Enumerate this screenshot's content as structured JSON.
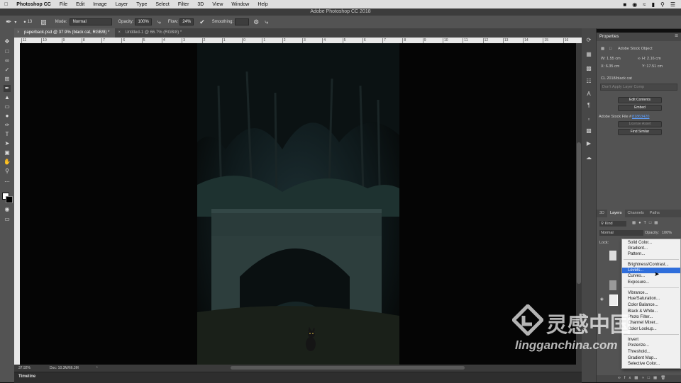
{
  "menubar": {
    "app": "Photoshop CC",
    "items": [
      "File",
      "Edit",
      "Image",
      "Layer",
      "Type",
      "Select",
      "Filter",
      "3D",
      "View",
      "Window",
      "Help"
    ]
  },
  "window_title": "Adobe Photoshop CC 2018",
  "options": {
    "size": "13",
    "mode_label": "Mode:",
    "mode_value": "Normal",
    "opacity_label": "Opacity:",
    "opacity_value": "100%",
    "flow_label": "Flow:",
    "flow_value": "24%",
    "smoothing_label": "Smoothing:"
  },
  "tabs": [
    {
      "label": "paperback.psd @ 37.9% (black cat, RGB/8) *",
      "active": true
    },
    {
      "label": "Untitled-1 @ 66.7% (RGB/8) *",
      "active": false
    }
  ],
  "ruler": {
    "ticks": [
      "11",
      "10",
      "9",
      "8",
      "7",
      "6",
      "5",
      "4",
      "3",
      "2",
      "1",
      "0",
      "1",
      "2",
      "3",
      "4",
      "5",
      "6",
      "7",
      "8",
      "9",
      "10",
      "11",
      "12",
      "13",
      "14",
      "15",
      "16"
    ]
  },
  "status": {
    "zoom": "37.92%",
    "doc": "Doc: 10.3M/66.3M"
  },
  "timeline_label": "Timeline",
  "properties": {
    "title": "Properties",
    "object_type": "Adobe Stock Object",
    "w": "W:  1.55 cm",
    "h": "H:  2.16 cm",
    "x": "X:  6.35 cm",
    "y": "Y:  17.51 cm",
    "layer_name": "CL 2018/black cat",
    "comp_placeholder": "Don't Apply Layer Comp",
    "edit_contents": "Edit Contents",
    "embed": "Embed",
    "stock_file": "Adobe Stock File #",
    "stock_id": "81863420",
    "license_asset": "License Asset",
    "find_similar": "Find Similar"
  },
  "layers": {
    "tabs": [
      "3D",
      "Layers",
      "Channels",
      "Paths"
    ],
    "kind": "Kind",
    "blend": "Normal",
    "opacity_label": "Opacity:",
    "opacity_value": "100%",
    "lock_label": "Lock:"
  },
  "adjust_menu": {
    "group1": [
      "Solid Color...",
      "Gradient...",
      "Pattern..."
    ],
    "group2": [
      "Brightness/Contrast...",
      "Levels...",
      "Curves...",
      "Exposure..."
    ],
    "group3": [
      "Vibrance...",
      "Hue/Saturation...",
      "Color Balance...",
      "Black & White...",
      "Photo Filter...",
      "Channel Mixer...",
      "Color Lookup..."
    ],
    "group4": [
      "Invert",
      "Posterize...",
      "Threshold...",
      "Gradient Map...",
      "Selective Color..."
    ],
    "highlighted": "Levels..."
  },
  "watermark": {
    "brand": "灵感中国",
    "url": "lingganchina.com"
  },
  "colors": {
    "accent": "#2f6edb",
    "panel": "#535353",
    "canvas": "#050505"
  }
}
